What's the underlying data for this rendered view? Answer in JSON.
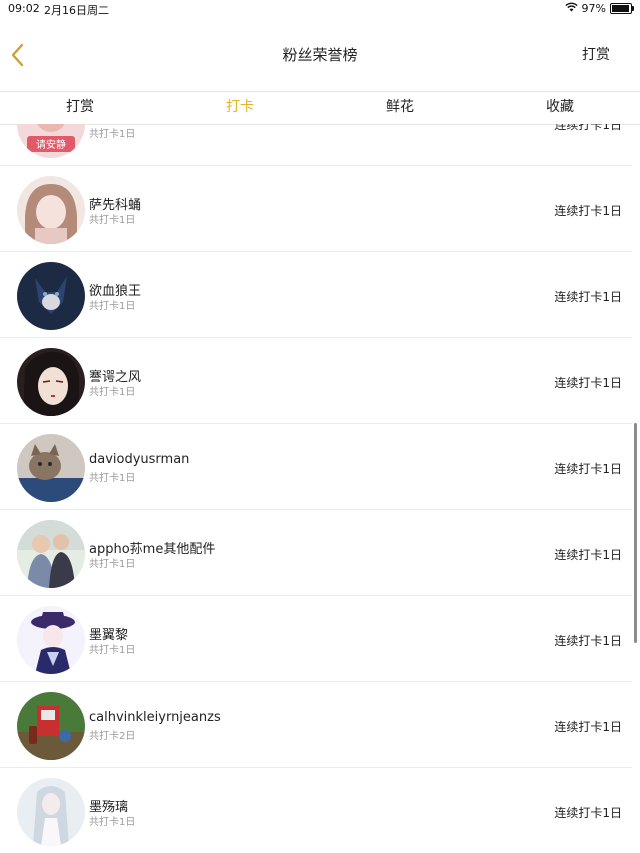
{
  "status_bar": {
    "time": "09:02",
    "date": "2月16日周二",
    "battery": "97%",
    "battery_level": 0.97
  },
  "header": {
    "title": "粉丝荣誉榜",
    "right_button": "打赏"
  },
  "tabs": [
    {
      "label": "打赏",
      "active": false
    },
    {
      "label": "打卡",
      "active": true
    },
    {
      "label": "鲜花",
      "active": false
    },
    {
      "label": "收藏",
      "active": false
    }
  ],
  "colors": {
    "accent": "#e6b422",
    "back_arrow": "#c8a23c"
  },
  "fans": [
    {
      "name": "",
      "total": "共打卡1日",
      "streak": "连续打卡1日",
      "avatar_label": "请安静",
      "avatar": "a0"
    },
    {
      "name": "萨先科蛹",
      "total": "共打卡1日",
      "streak": "连续打卡1日",
      "avatar": "a1"
    },
    {
      "name": "欲血狼王",
      "total": "共打卡1日",
      "streak": "连续打卡1日",
      "avatar": "a2"
    },
    {
      "name": "謇谔之风",
      "total": "共打卡1日",
      "streak": "连续打卡1日",
      "avatar": "a3"
    },
    {
      "name": "daviodyusrman",
      "total": "共打卡1日",
      "streak": "连续打卡1日",
      "avatar": "a4"
    },
    {
      "name": "appho荪me其他配件",
      "total": "共打卡1日",
      "streak": "连续打卡1日",
      "avatar": "a5"
    },
    {
      "name": "墨翼黎",
      "total": "共打卡1日",
      "streak": "连续打卡1日",
      "avatar": "a6"
    },
    {
      "name": "calhvinkleiyrnjeanzs",
      "total": "共打卡2日",
      "streak": "连续打卡1日",
      "avatar": "a7"
    },
    {
      "name": "墨殇璃",
      "total": "共打卡1日",
      "streak": "连续打卡1日",
      "avatar": "a8"
    }
  ]
}
